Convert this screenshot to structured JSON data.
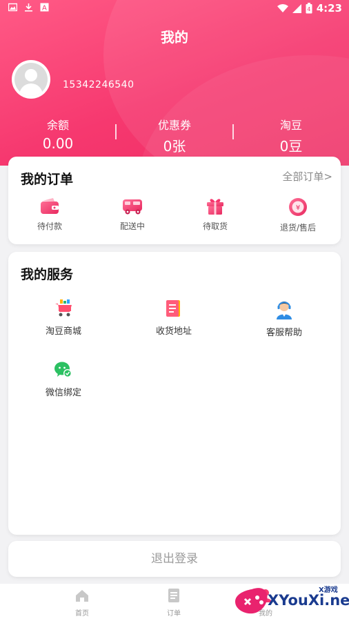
{
  "status_bar": {
    "time": "4:23",
    "battery_level": "4"
  },
  "header": {
    "title": "我的",
    "phone": "15342246540",
    "stats": [
      {
        "label": "余额",
        "value": "0.00"
      },
      {
        "label": "优惠券",
        "value": "0张"
      },
      {
        "label": "淘豆",
        "value": "0豆"
      }
    ]
  },
  "orders": {
    "title": "我的订单",
    "all_link": "全部订单>",
    "items": [
      {
        "label": "待付款",
        "icon": "wallet-icon"
      },
      {
        "label": "配送中",
        "icon": "truck-icon"
      },
      {
        "label": "待取货",
        "icon": "gift-icon"
      },
      {
        "label": "退货/售后",
        "icon": "refund-icon"
      }
    ]
  },
  "services": {
    "title": "我的服务",
    "items": [
      {
        "label": "淘豆商城",
        "icon": "cart-icon"
      },
      {
        "label": "收货地址",
        "icon": "address-book-icon"
      },
      {
        "label": "客服帮助",
        "icon": "customer-service-icon"
      },
      {
        "label": "微信绑定",
        "icon": "wechat-icon"
      }
    ]
  },
  "logout_label": "退出登录",
  "tabbar": [
    {
      "label": "首页",
      "icon": "home-icon"
    },
    {
      "label": "订单",
      "icon": "orders-icon"
    },
    {
      "label": "我的",
      "icon": "profile-icon"
    }
  ],
  "watermark": {
    "text": "XYouXi.net",
    "small": "X游戏"
  },
  "colors": {
    "brand": "#f6386f",
    "accent_orange": "#ff7a3d"
  }
}
